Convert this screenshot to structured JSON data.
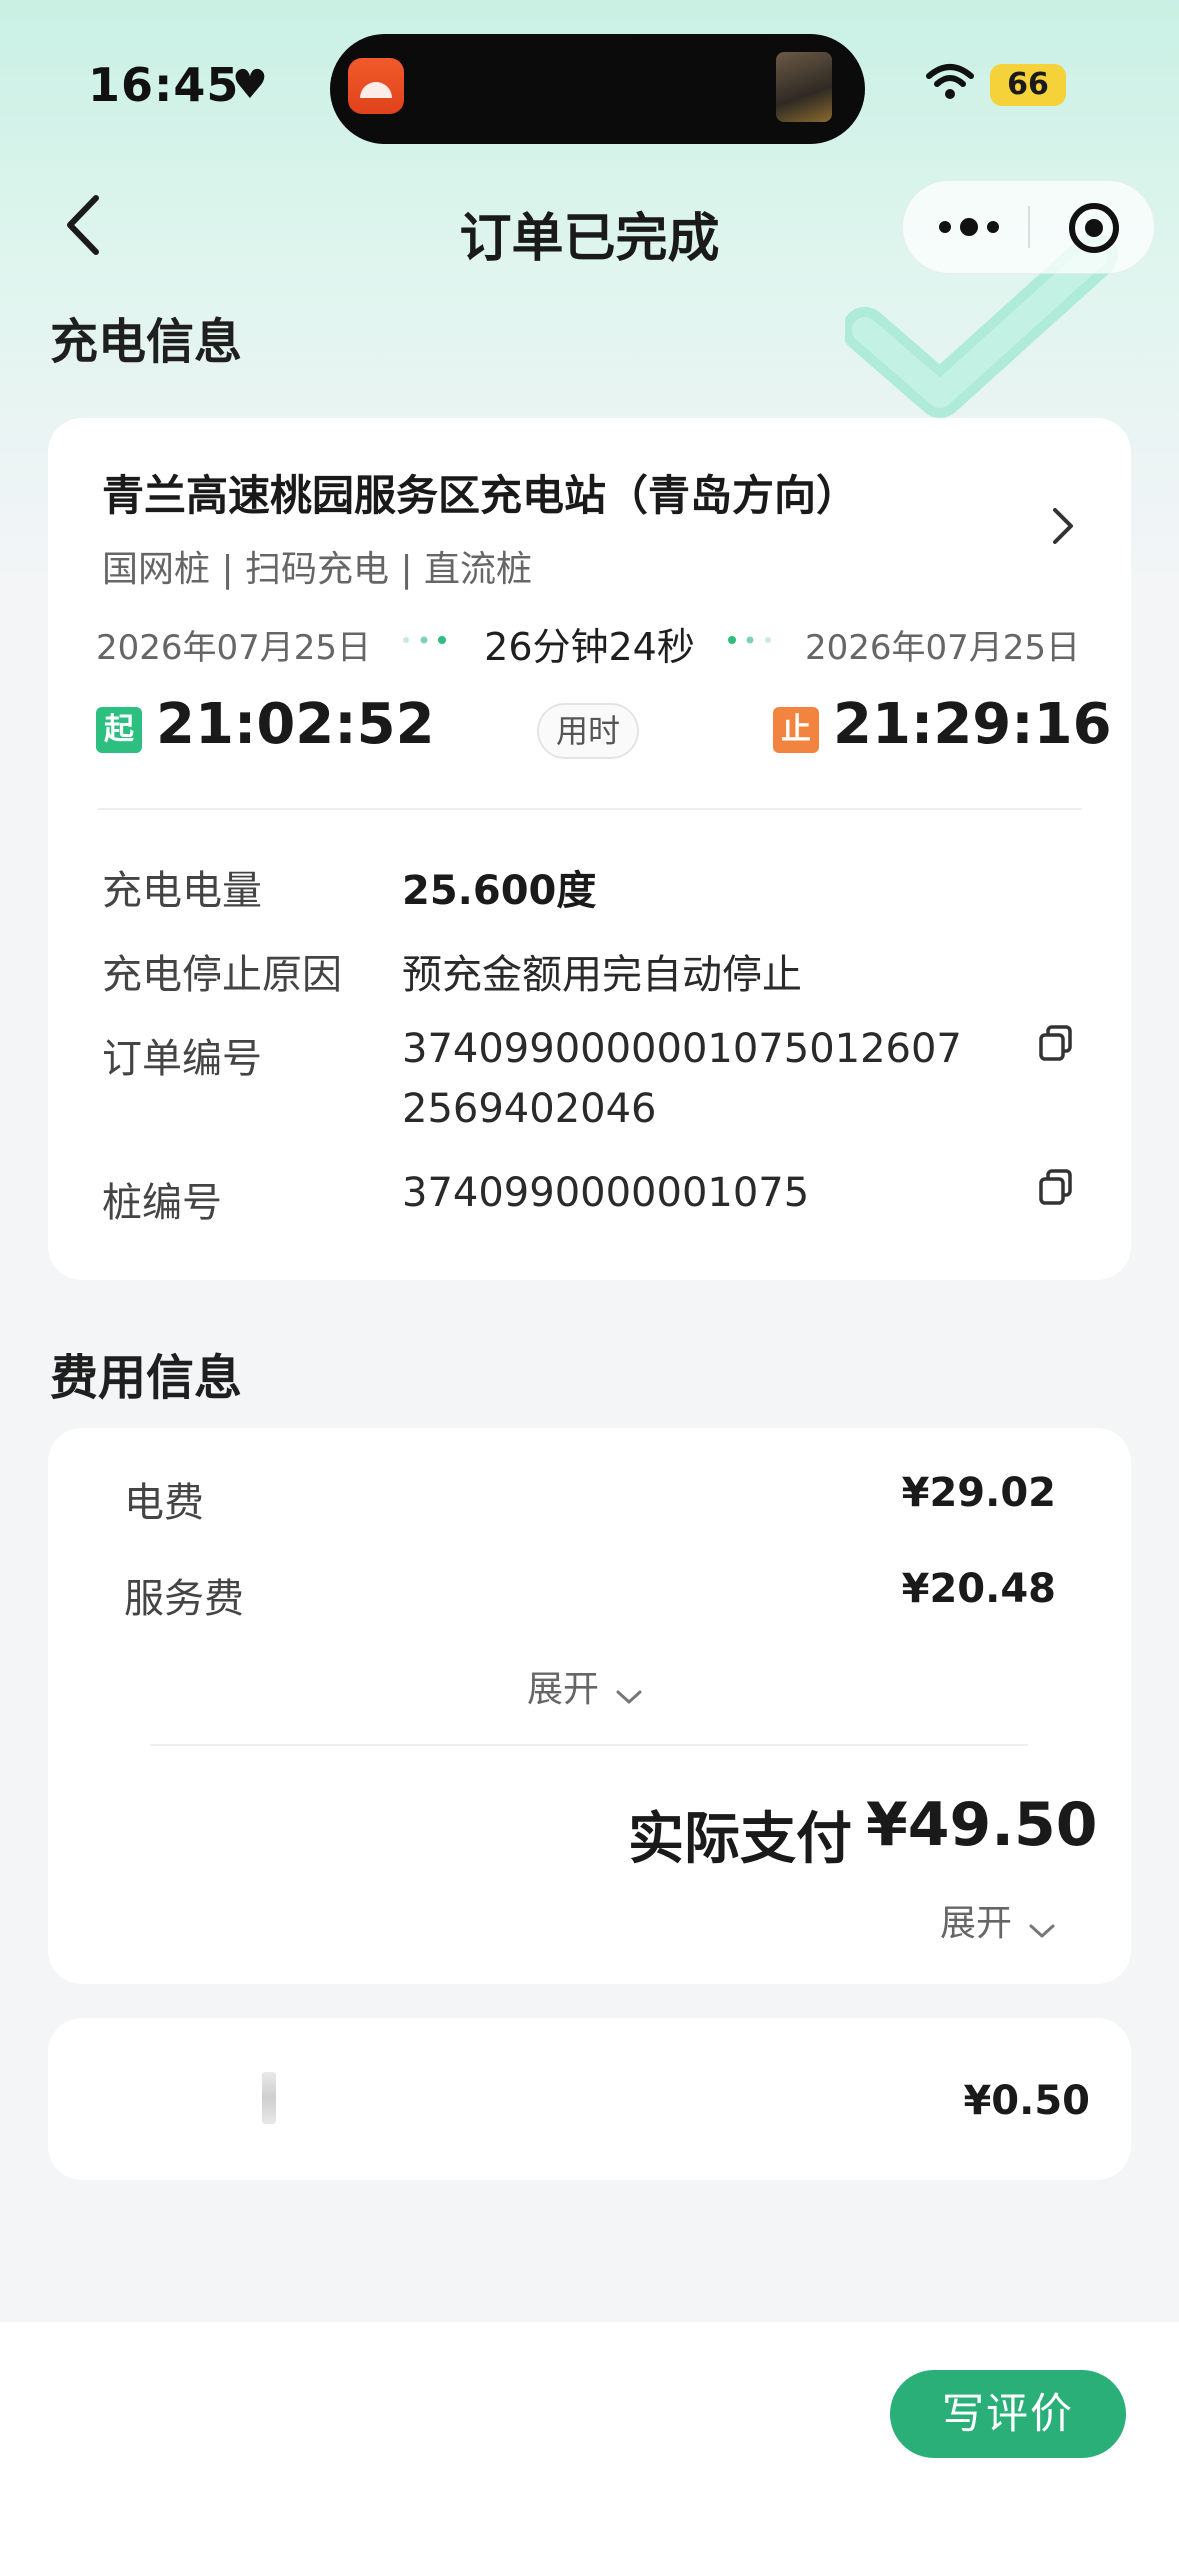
{
  "status_bar": {
    "time": "16:45",
    "battery": "66"
  },
  "nav": {
    "title": "订单已完成",
    "back_icon": "chevron-left-icon",
    "more_icon": "more-dots-icon",
    "close_icon": "target-icon"
  },
  "charging_section": {
    "title": "充电信息",
    "station_name": "青兰高速桃园服务区充电站（青岛方向）",
    "station_tags": "国网桩 | 扫码充电 | 直流桩",
    "start_date": "2026年07月25日",
    "end_date": "2026年07月25日",
    "duration": "26分钟24秒",
    "start_badge": "起",
    "end_badge": "止",
    "start_time": "21:02:52",
    "end_time": "21:29:16",
    "used_label": "用时",
    "rows": [
      {
        "label": "充电电量",
        "value": "25.600度"
      },
      {
        "label": "充电停止原因",
        "value": "预充金额用完自动停止"
      },
      {
        "label": "订单编号",
        "value_line1": "374099000000107501260​7",
        "value_line2": "2569402046"
      },
      {
        "label": "桩编号",
        "value": "3740990000001075"
      }
    ]
  },
  "fee_section": {
    "title": "费用信息",
    "items": [
      {
        "label": "电费",
        "value": "¥29.02"
      },
      {
        "label": "服务费",
        "value": "¥20.48"
      }
    ],
    "expand_label": "展开",
    "total_label": "实际支付",
    "total_value": "¥49.50",
    "expand_label_2": "展开"
  },
  "extra_card": {
    "value": "¥0.50"
  },
  "bottom": {
    "review_button": "写评价"
  },
  "colors": {
    "accent_green": "#2aaf79",
    "start_badge": "#2cbf7f",
    "end_badge": "#f2843f"
  }
}
